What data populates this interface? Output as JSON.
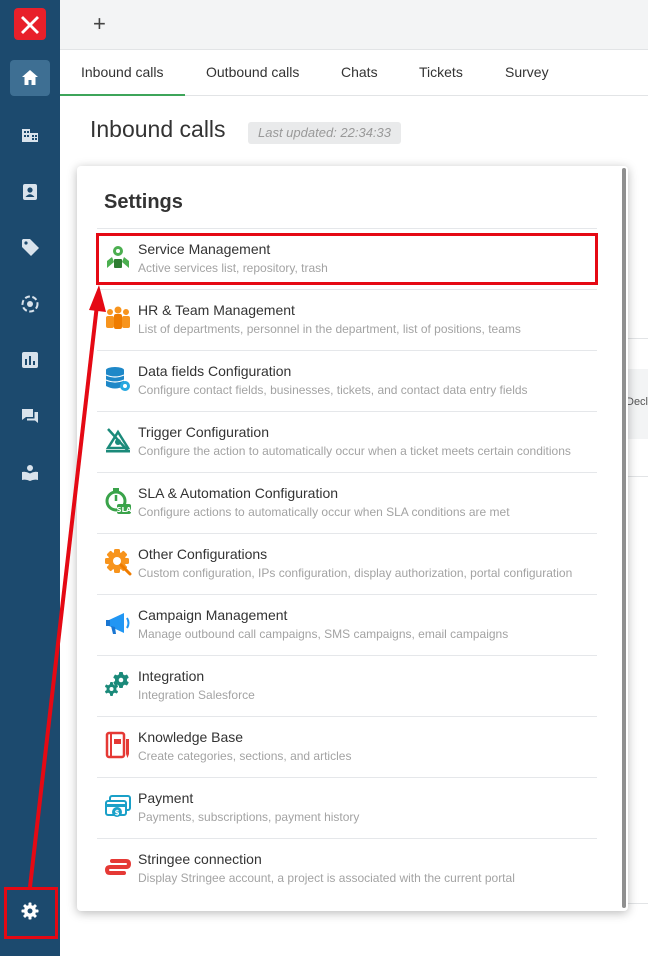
{
  "topbar": {
    "new_tab_label": "+"
  },
  "tabs": [
    {
      "label": "Inbound calls"
    },
    {
      "label": "Outbound calls"
    },
    {
      "label": "Chats"
    },
    {
      "label": "Tickets"
    },
    {
      "label": "Survey"
    }
  ],
  "page": {
    "title": "Inbound calls",
    "last_updated": "Last updated: 22:34:33"
  },
  "background_table": {
    "partial_header": "Decl"
  },
  "sidebar": {
    "items": [
      {
        "icon": "home-icon"
      },
      {
        "icon": "building-icon"
      },
      {
        "icon": "contact-icon"
      },
      {
        "icon": "tag-icon"
      },
      {
        "icon": "target-icon"
      },
      {
        "icon": "report-icon"
      },
      {
        "icon": "chat-icon"
      },
      {
        "icon": "knowledge-icon"
      }
    ],
    "settings_icon": "gear-icon"
  },
  "settings_panel": {
    "title": "Settings",
    "items": [
      {
        "title": "Service Management",
        "desc": "Active services list, repository, trash",
        "icon": "service-icon"
      },
      {
        "title": "HR & Team Management",
        "desc": "List of departments, personnel in the department, list of positions, teams",
        "icon": "team-icon"
      },
      {
        "title": "Data fields Configuration",
        "desc": "Configure contact fields, businesses, tickets, and contact data entry fields",
        "icon": "database-icon"
      },
      {
        "title": "Trigger Configuration",
        "desc": "Configure the action to automatically occur when a ticket meets certain conditions",
        "icon": "trigger-icon"
      },
      {
        "title": "SLA & Automation Configuration",
        "desc": "Configure actions to automatically occur when SLA conditions are met",
        "icon": "sla-icon"
      },
      {
        "title": "Other Configurations",
        "desc": "Custom configuration, IPs configuration, display authorization, portal configuration",
        "icon": "cog-wrench-icon"
      },
      {
        "title": "Campaign Management",
        "desc": "Manage outbound call campaigns, SMS campaigns, email campaigns",
        "icon": "megaphone-icon"
      },
      {
        "title": "Integration",
        "desc": "Integration Salesforce",
        "icon": "integration-gears-icon"
      },
      {
        "title": "Knowledge Base",
        "desc": "Create categories, sections, and articles",
        "icon": "book-icon"
      },
      {
        "title": "Payment",
        "desc": "Payments, subscriptions, payment history",
        "icon": "payment-icon"
      },
      {
        "title": "Stringee connection",
        "desc": "Display Stringee account, a project is associated with the current portal",
        "icon": "stringee-icon"
      }
    ]
  },
  "colors": {
    "sidebar": "#1c4a6e",
    "sidebar_active": "#3e6f93",
    "logo": "#e8202a",
    "tab_underline": "#3ea55a",
    "highlight": "#e50914"
  }
}
